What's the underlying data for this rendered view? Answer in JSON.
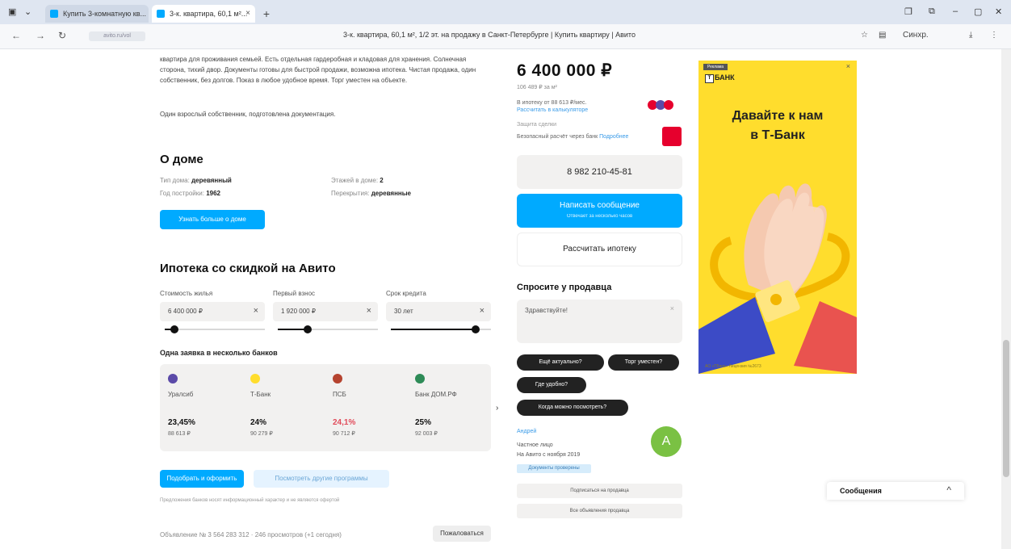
{
  "browser": {
    "tabs": [
      {
        "title": "Купить 3-комнатную кв..."
      },
      {
        "title": "3-к. квартира, 60,1 м²..."
      }
    ],
    "new_tab": "+",
    "url_pill": "avito.ru/vol",
    "url": "3-к. квартира, 60,1 м², 1/2 эт. на продажу в Санкт-Петербурге | Купить квартиру | Авито",
    "profile": "Синхр."
  },
  "description": {
    "text": "квартира для проживания семьей. Есть отдельная гардеробная и кладовая для хранения. Солнечная сторона, тихий двор. Документы готовы для быстрой продажи, возможна ипотека. Чистая продажа, один собственник, без долгов. Показ в любое удобное время. Торг уместен на объекте.",
    "owner_note": "Один взрослый собственник, подготовлена документация."
  },
  "house": {
    "title": "О доме",
    "type_label": "Тип дома",
    "type_value": "деревянный",
    "year_label": "Год постройки",
    "year_value": "1962",
    "floors_label": "Этажей в доме",
    "floors_value": "2",
    "overlaps_label": "Перекрытия",
    "overlaps_value": "деревянные",
    "button": "Узнать больше о доме"
  },
  "mortgage": {
    "title": "Ипотека со скидкой на Авито",
    "fields": [
      {
        "label": "Стоимость жилья",
        "value": "6 400 000 ₽"
      },
      {
        "label": "Первый взнос",
        "value": "1 920 000 ₽"
      },
      {
        "label": "Срок кредита",
        "value": "30 лет"
      }
    ],
    "sliders": [
      0.1,
      0.3,
      0.85
    ],
    "banks_title": "Одна заявка в несколько банков",
    "banks": [
      {
        "name": "Уралсиб",
        "rate": "23,45%",
        "payment": "88 613 ₽",
        "color": "#5b4aa8"
      },
      {
        "name": "Т-Банк",
        "rate": "24%",
        "payment": "90 279 ₽",
        "color": "#ffdd2d"
      },
      {
        "name": "ПСБ",
        "rate": "24,1%",
        "payment": "90 712 ₽",
        "color": "#b5432f"
      },
      {
        "name": "Банк ДОМ.РФ",
        "rate": "25%",
        "payment": "92 003 ₽",
        "color": "#2e8b57"
      }
    ],
    "more_arrow": "›",
    "apply_button": "Подобрать и оформить",
    "other_button": "Посмотреть другие программы",
    "note": "Предложения банков носят информационный характер и не являются офертой"
  },
  "bottom": {
    "text": "Объявление № 3 564 283 312 · 246 просмотров (+1 сегодня)",
    "button": "Пожаловаться"
  },
  "sidebar": {
    "price": "6 400 000 ₽",
    "price_m2": "106 489 ₽ за м²",
    "mortgage_line": "В ипотеку от 88 613 ₽/мес.",
    "mortgage_link": "Рассчитать в калькуляторе",
    "escrow_label": "Защита сделки",
    "escrow_line": "Безопасный расчёт через банк",
    "escrow_link": "Подробнее",
    "phone": "8 982 210-45-81",
    "write_button": "Написать сообщение",
    "write_sub": "Отвечает за несколько часов",
    "calc_button": "Рассчитать ипотеку",
    "ask_title": "Спросите у продавца",
    "ask_placeholder": "Здравствуйте!",
    "ask_close": "×",
    "chips": [
      "Ещё актуально?",
      "Торг уместен?",
      "Где удобно?",
      "Когда можно посмотреть?"
    ],
    "seller_name": "Андрей",
    "seller_type": "Частное лицо",
    "seller_since": "На Авито с ноября 2019",
    "seller_badge": "Документы проверены",
    "avatar_letter": "А",
    "subscribe_button": "Подписаться на продавца",
    "more_button": "Все объявления продавца"
  },
  "ad": {
    "tag": "Реклама",
    "close": "×",
    "brand_mark": "Т",
    "brand": "БАНК",
    "headline_1": "Давайте к нам",
    "headline_2": "в Т-Банк",
    "footer": "АО «ТБанк» Лицензия №2673"
  },
  "messages": {
    "title": "Сообщения",
    "chevron": "^"
  },
  "colors": {
    "accent": "#00aaff",
    "ad_bg": "#ffdd2d",
    "avatar": "#7ac143"
  }
}
